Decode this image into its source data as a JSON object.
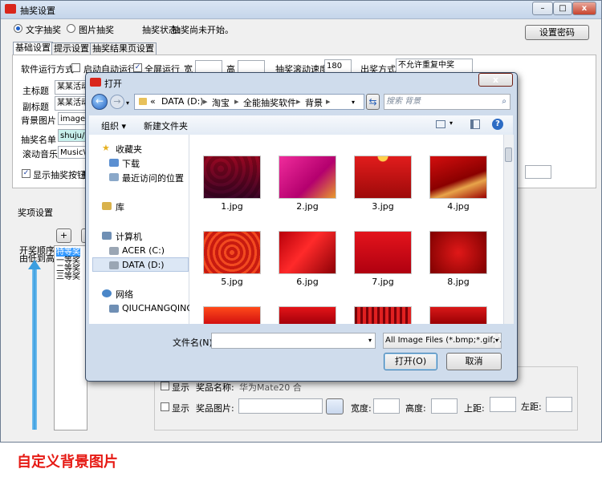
{
  "window": {
    "title": "抽奖设置",
    "minimize": "–",
    "maximize": "□",
    "close": "x"
  },
  "mode": {
    "text_option": "文字抽奖",
    "image_option": "图片抽奖",
    "status_label": "抽奖状态:",
    "status_value": "抽奖尚未开始。",
    "password_button": "设置密码"
  },
  "tabs": [
    "基础设置",
    "提示设置",
    "抽奖结果页设置"
  ],
  "basic": {
    "run_mode_label": "软件运行方式",
    "autostart_label": "启动自动运行",
    "fullscreen_label": "全屏运行",
    "width_label": "宽",
    "height_label": "高",
    "scroll_speed_label": "抽奖滚动速度",
    "scroll_speed_value": "180",
    "draw_mode_label": "出奖方式",
    "draw_mode_value": "不允许重复中奖",
    "main_title_label": "主标题",
    "main_title_value": "某某活动",
    "sub_title_label": "副标题",
    "sub_title_value": "某某活动",
    "bg_image_label": "背景图片",
    "bg_image_value": "images\\",
    "list_label": "抽奖名单",
    "list_value": "shuju/",
    "music_label": "滚动音乐",
    "music_value": "Music\\滚",
    "show_button_label": "显示抽奖按钮",
    "show_button_tail": "抽"
  },
  "prizes": {
    "title": "奖项设置",
    "add": "+",
    "order_label_1": "开奖顺序",
    "order_label_2": "由低到高",
    "items": [
      "特等奖",
      "一等奖",
      "二等奖",
      "三等奖"
    ],
    "row1_show": "显示",
    "row1_name_label": "奖品名称:",
    "row1_name_value": "华为Mate20 合",
    "row2_show": "显示",
    "row2_image_label": "奖品图片:",
    "row2_width_label": "宽度:",
    "row2_height_label": "高度:",
    "row2_top_label": "上距:",
    "row2_left_label": "左距:"
  },
  "dialog": {
    "title": "打开",
    "path_prefix": "«",
    "path": [
      "DATA (D:)",
      "淘宝",
      "全能抽奖软件",
      "背景"
    ],
    "search_placeholder": "搜索 背景",
    "organize": "组织 ▾",
    "new_folder": "新建文件夹",
    "nav": {
      "favorites": "收藏夹",
      "downloads": "下载",
      "recent": "最近访问的位置",
      "libraries": "库",
      "computer": "计算机",
      "acer": "ACER (C:)",
      "data": "DATA (D:)",
      "network": "网络",
      "host": "QIUCHANGQING-"
    },
    "files": [
      "1.jpg",
      "2.jpg",
      "3.jpg",
      "4.jpg",
      "5.jpg",
      "6.jpg",
      "7.jpg",
      "8.jpg"
    ],
    "filename_label": "文件名(N):",
    "filetype": "All Image Files (*.bmp;*.gif;*.",
    "open_button": "打开(O)",
    "cancel_button": "取消"
  },
  "caption": "自定义背景图片",
  "colors": {
    "accent": "#d9261c",
    "selection": "#3399ff"
  }
}
